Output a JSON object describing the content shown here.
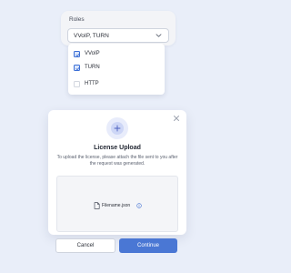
{
  "roles": {
    "label": "Roles",
    "selected_value": "VVoIP, TURN",
    "options": [
      {
        "label": "VVoIP",
        "checked": true
      },
      {
        "label": "TURN",
        "checked": true
      },
      {
        "label": "HTTP",
        "checked": false
      }
    ]
  },
  "upload_modal": {
    "title": "License Upload",
    "description": "To upload the license, please attach the file sent to you after the request was generated.",
    "file_name": "Filename.json",
    "cancel_label": "Cancel",
    "continue_label": "Continue"
  },
  "colors": {
    "background": "#e9eef9",
    "accent": "#4a77d4",
    "checkbox_checked": "#3b6fd6"
  },
  "icons": {
    "chevron": "chevron-down-icon",
    "close": "close-icon",
    "plus": "plus-icon",
    "file": "file-icon",
    "info": "info-icon",
    "check": "check-icon"
  }
}
